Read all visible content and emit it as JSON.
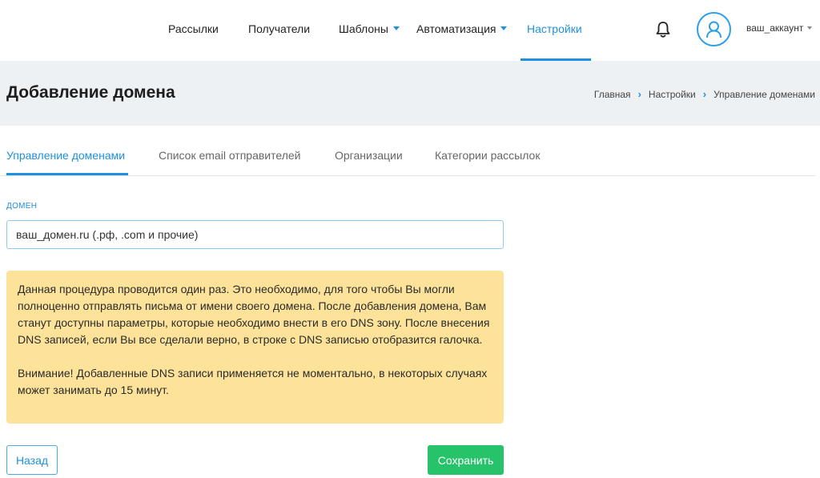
{
  "nav": {
    "items": [
      {
        "label": "Рассылки"
      },
      {
        "label": "Получатели"
      },
      {
        "label": "Шаблоны"
      },
      {
        "label": "Автоматизация"
      },
      {
        "label": "Настройки"
      }
    ],
    "active_item": "Настройки",
    "account_label": "ваш_аккаунт"
  },
  "header": {
    "title": "Добавление домена",
    "breadcrumb": [
      "Главная",
      "Настройки",
      "Управление доменами"
    ]
  },
  "tabs": [
    {
      "label": "Управление доменами"
    },
    {
      "label": "Список email отправителей"
    },
    {
      "label": "Организации"
    },
    {
      "label": "Категории рассылок"
    }
  ],
  "active_tab": "Управление доменами",
  "form": {
    "domain_label": "ДОМЕН",
    "domain_placeholder": "ваш_домен.ru (.рф, .com и прочие)",
    "domain_value": ""
  },
  "notice": {
    "paragraph1": "Данная процедура проводится один раз. Это необходимо, для того чтобы Вы могли полноценно отправлять письма от имени своего домена. После добавления домена, Вам станут доступны параметры, которые необходимо внести в его DNS зону. После внесения DNS записей, если Вы все сделали верно, в строке с DNS записью отобразится галочка.",
    "paragraph2": "Внимание! Добавленные DNS записи применяется не моментально, в некоторых случаях может занимать до 15 минут."
  },
  "actions": {
    "back_label": "Назад",
    "save_label": "Сохранить"
  },
  "colors": {
    "accent": "#1e90e0",
    "save_button": "#27c36a",
    "notice_bg": "#fde39a",
    "header_bg": "#eef1f3"
  }
}
